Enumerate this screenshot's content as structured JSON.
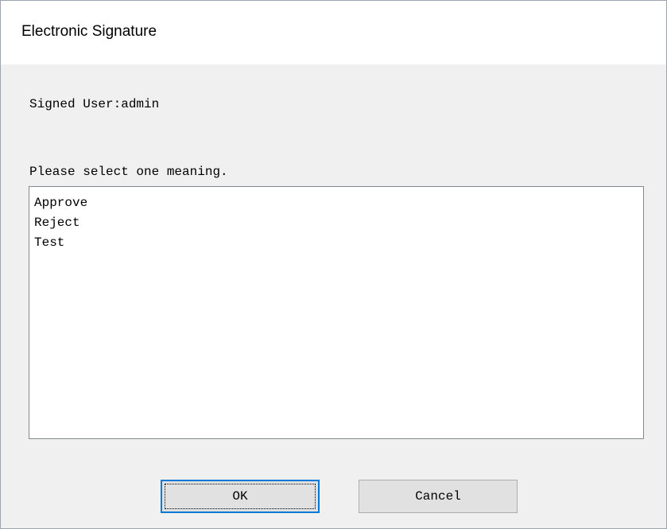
{
  "window": {
    "title": "Electronic Signature"
  },
  "signed_user": {
    "text": "Signed User:admin"
  },
  "meaning": {
    "label": "Please select one meaning.",
    "options": [
      "Approve",
      "Reject",
      "Test"
    ]
  },
  "buttons": {
    "ok_label": "OK",
    "cancel_label": "Cancel"
  }
}
